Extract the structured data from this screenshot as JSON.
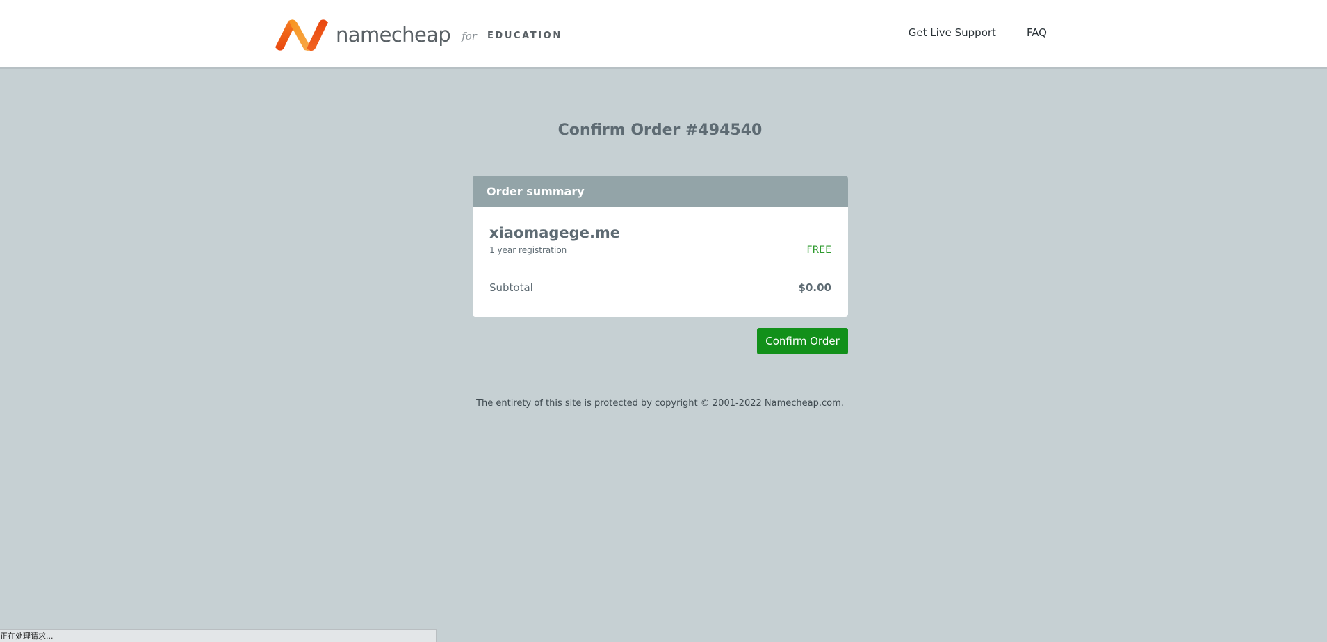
{
  "header": {
    "logo": {
      "brand": "namecheap",
      "for": "for",
      "program": "EDUCATION"
    },
    "nav": [
      {
        "label": "Get Live Support"
      },
      {
        "label": "FAQ"
      }
    ]
  },
  "main": {
    "title": "Confirm Order #494540",
    "order_summary": {
      "heading": "Order summary",
      "item": {
        "domain": "xiaomagege.me",
        "term": "1 year registration",
        "price": "FREE"
      },
      "subtotal_label": "Subtotal",
      "subtotal_value": "$0.00"
    },
    "confirm_button": "Confirm Order"
  },
  "footer": {
    "copyright": "The entirety of this site is protected by copyright © 2001-2022 Namecheap.com."
  },
  "status_bar": {
    "text": "正在处理请求..."
  },
  "colors": {
    "brand_orange": "#f15a24",
    "brand_orange_light": "#f7931e",
    "page_background": "#c6d0d3",
    "summary_header": "#93a4a8",
    "confirm_green": "#12901a",
    "free_green": "#2e9a2e"
  }
}
